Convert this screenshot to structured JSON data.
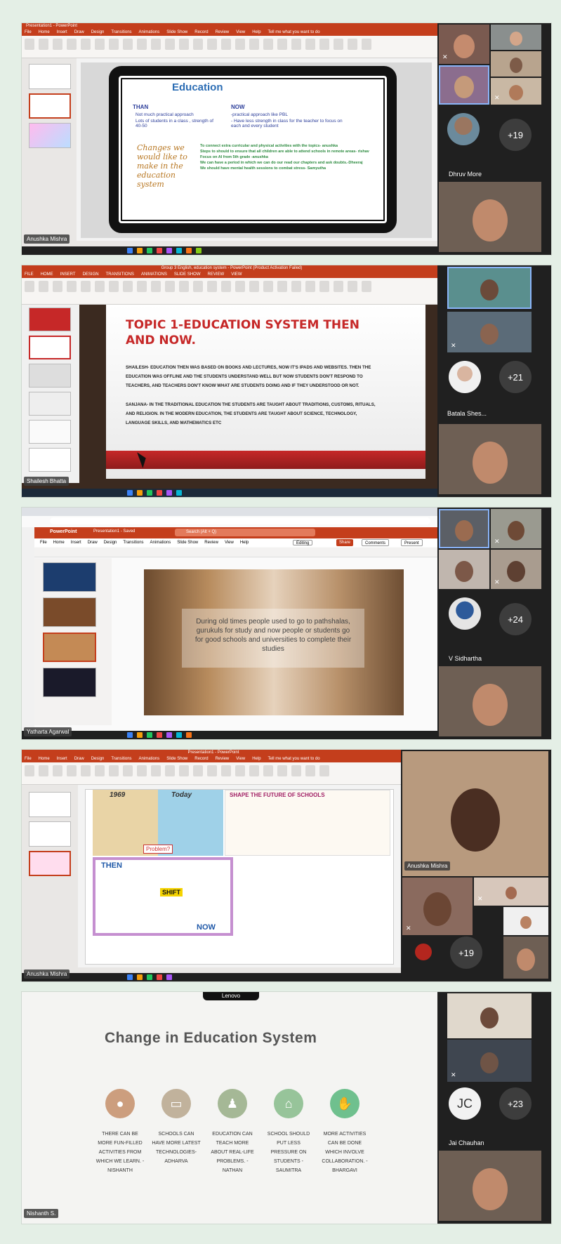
{
  "panels": [
    {
      "app_title": "Presentation1 - PowerPoint",
      "menu": [
        "File",
        "Home",
        "Insert",
        "Draw",
        "Design",
        "Transitions",
        "Animations",
        "Slide Show",
        "Record",
        "Review",
        "View",
        "Help",
        "Tell me what you want to do"
      ],
      "slide": {
        "title": "Education",
        "than_heading": "THAN",
        "than_items": [
          "Not much practical approach",
          "Lots of students in a class , strength of 40-50"
        ],
        "now_heading": "NOW",
        "now_items": [
          "-practical approach like PBL",
          "- Have less strength in class for the teacher to focus on each and every student"
        ],
        "changes_heading": "Changes we would like to make in the education system",
        "changes_items": [
          "To connect extra curricular and physical activities with the topics- anushka",
          "Steps to should to ensure that all children are able to attend schools in remote areas- rishav",
          "Focus on AI from 5th grade -anushka",
          "We can have a period in which we can do our read our chapters and ask doubts.-Dheeraj",
          "We should have mental health sessions to combat stress- Samyutha"
        ]
      },
      "presenter": "Anushka Mishra",
      "participant_name": "Dhruv More",
      "more_count": "+19"
    },
    {
      "app_title": "Group 3 English, education system - PowerPoint (Product Activation Failed)",
      "menu": [
        "FILE",
        "HOME",
        "INSERT",
        "DESIGN",
        "TRANSITIONS",
        "ANIMATIONS",
        "SLIDE SHOW",
        "REVIEW",
        "VIEW"
      ],
      "slide": {
        "title": "TOPIC 1-EDUCATION SYSTEM THEN AND NOW.",
        "body1": "SHAILESH- EDUCATION THEN WAS BASED ON BOOKS AND LECTURES, NOW IT'S IPADS AND WEBSITES. THEN THE EDUCATION WAS OFFLINE AND THE STUDENTS UNDERSTAND WELL BUT NOW STUDENTS DON'T RESPOND TO TEACHERS, AND TEACHERS DON'T KNOW WHAT ARE STUDENTS DOING AND IF THEY UNDERSTOOD OR NOT.",
        "body2": "SANJANA- IN THE TRADITIONAL EDUCATION THE STUDENTS ARE TAUGHT ABOUT TRADITIONS, CUSTOMS, RITUALS, AND RELIGION. IN THE MODERN EDUCATION, THE STUDENTS ARE TAUGHT ABOUT SCIENCE, TECHNOLOGY, LANGUAGE SKILLS, AND MATHEMATICS ETC"
      },
      "presenter": "Shailesh Bhatta",
      "participant_name": "Batala Shes...",
      "more_count": "+21"
    },
    {
      "app_title": "PowerPoint",
      "doc_title": "Presentation1 - Saved",
      "search_placeholder": "Search (Alt + Q)",
      "menu": [
        "File",
        "Home",
        "Insert",
        "Draw",
        "Design",
        "Transitions",
        "Animations",
        "Slide Show",
        "Review",
        "View",
        "Help"
      ],
      "editing_label": "Editing",
      "share_label": "Share",
      "comments_label": "Comments",
      "present_label": "Present",
      "slide_text": "During old times people used to go to pathshalas, gurukuls for study and now people or students go for good schools and universities to complete their studies",
      "presenter": "Yatharta Agarwal",
      "participant_name": "V Sidhartha",
      "more_count": "+24"
    },
    {
      "app_title": "Presentation1 - PowerPoint",
      "menu": [
        "File",
        "Home",
        "Insert",
        "Draw",
        "Design",
        "Transitions",
        "Animations",
        "Slide Show",
        "Record",
        "Review",
        "View",
        "Help",
        "Tell me what you want to do"
      ],
      "img1_year": "1969",
      "img1_today": "Today",
      "img1_problem": "Problem?",
      "img2_title": "SHAPE THE FUTURE OF SCHOOLS",
      "img3_then": "THEN",
      "img3_now": "NOW",
      "img3_shift": "SHIFT",
      "presenter": "Anushka Mishra",
      "participant_name": "Anushka Mishra",
      "more_count": "+19"
    },
    {
      "brand": "Lenovo",
      "title": "Change in Education System",
      "items": [
        "THERE CAN BE MORE FUN-FILLED ACTIVITIES FROM WHICH WE LEARN. - NISHANTH",
        "SCHOOLS CAN HAVE MORE LATEST TECHNOLOGIES- ADHARVA",
        "EDUCATION CAN TEACH MORE ABOUT REAL-LIFE PROBLEMS. - NATHAN",
        "SCHOOL SHOULD PUT LESS PRESSURE ON STUDENTS - SAUMITRA",
        "MORE ACTIVITIES CAN BE DONE WHICH INVOLVE COLLABORATION. - BHARGAVI"
      ],
      "presenter": "Nishanth S.",
      "avatar_initials": "JC",
      "participant_name": "Jai Chauhan",
      "more_count": "+23"
    }
  ]
}
